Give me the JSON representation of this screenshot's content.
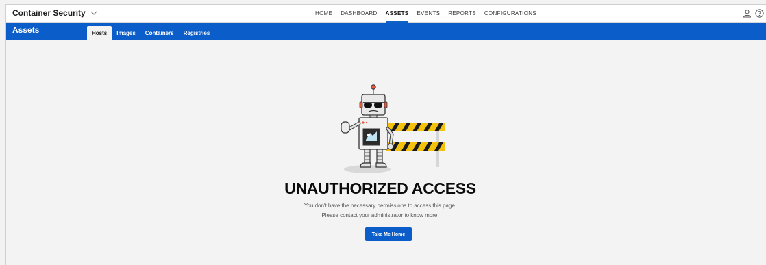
{
  "app": {
    "title": "Container Security"
  },
  "topnav": {
    "items": [
      {
        "label": "HOME"
      },
      {
        "label": "DASHBOARD"
      },
      {
        "label": "ASSETS",
        "active": true
      },
      {
        "label": "EVENTS"
      },
      {
        "label": "REPORTS"
      },
      {
        "label": "CONFIGURATIONS"
      }
    ]
  },
  "topicons": [
    "user-icon",
    "help-icon"
  ],
  "subheader": {
    "title": "Assets",
    "tabs": [
      {
        "label": "Hosts",
        "active": true
      },
      {
        "label": "Images"
      },
      {
        "label": "Containers"
      },
      {
        "label": "Registries"
      }
    ]
  },
  "main": {
    "heading": "UNAUTHORIZED ACCESS",
    "message_line1": "You don't have the necessary permissions to access this page.",
    "message_line2": "Please contact your administrator to know more.",
    "button_label": "Take Me Home",
    "illustration": "robot-barrier-icon"
  },
  "colors": {
    "brand_blue": "#0b5ec9",
    "background": "#f3f3f3",
    "barrier_yellow": "#f4c20d"
  }
}
